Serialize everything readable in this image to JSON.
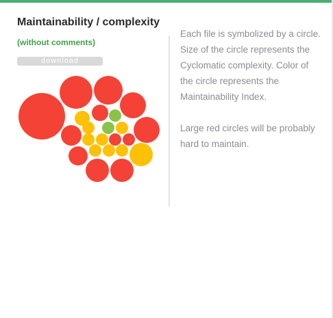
{
  "card": {
    "title": "Maintainability / complexity",
    "subtitle": "(without comments)",
    "download_label": "download",
    "description_1": "Each file is symbolized by a circle. Size of the circle represents the Cyclomatic complexity. Color of the circle represents the Maintainability Index.",
    "description_2": "Large red circles will be probably hard to maintain."
  },
  "colors": {
    "accent": "#4caf72",
    "subtitle": "#43a047",
    "high_complexity": "#f44336",
    "medium": "#ffc107",
    "good": "#8bc34a"
  },
  "chart_data": {
    "type": "bubble",
    "circles": [
      {
        "color": "#f44336",
        "size": 34
      },
      {
        "color": "#f44336",
        "size": 24
      },
      {
        "color": "#f44336",
        "size": 21
      },
      {
        "color": "#f44336",
        "size": 19
      },
      {
        "color": "#f44336",
        "size": 19
      },
      {
        "color": "#f44336",
        "size": 17
      },
      {
        "color": "#f44336",
        "size": 17
      },
      {
        "color": "#f44336",
        "size": 15
      },
      {
        "color": "#f44336",
        "size": 14
      },
      {
        "color": "#ffc107",
        "size": 17
      },
      {
        "color": "#f44336",
        "size": 12
      },
      {
        "color": "#ffc107",
        "size": 11
      },
      {
        "color": "#8bc34a",
        "size": 9
      },
      {
        "color": "#ffc107",
        "size": 9
      },
      {
        "color": "#8bc34a",
        "size": 9
      },
      {
        "color": "#ffc107",
        "size": 9
      },
      {
        "color": "#ffc107",
        "size": 9
      },
      {
        "color": "#ffc107",
        "size": 9
      },
      {
        "color": "#f44336",
        "size": 9
      },
      {
        "color": "#f44336",
        "size": 9
      },
      {
        "color": "#ffc107",
        "size": 9
      },
      {
        "color": "#ffc107",
        "size": 9
      },
      {
        "color": "#ffc107",
        "size": 9
      }
    ]
  }
}
